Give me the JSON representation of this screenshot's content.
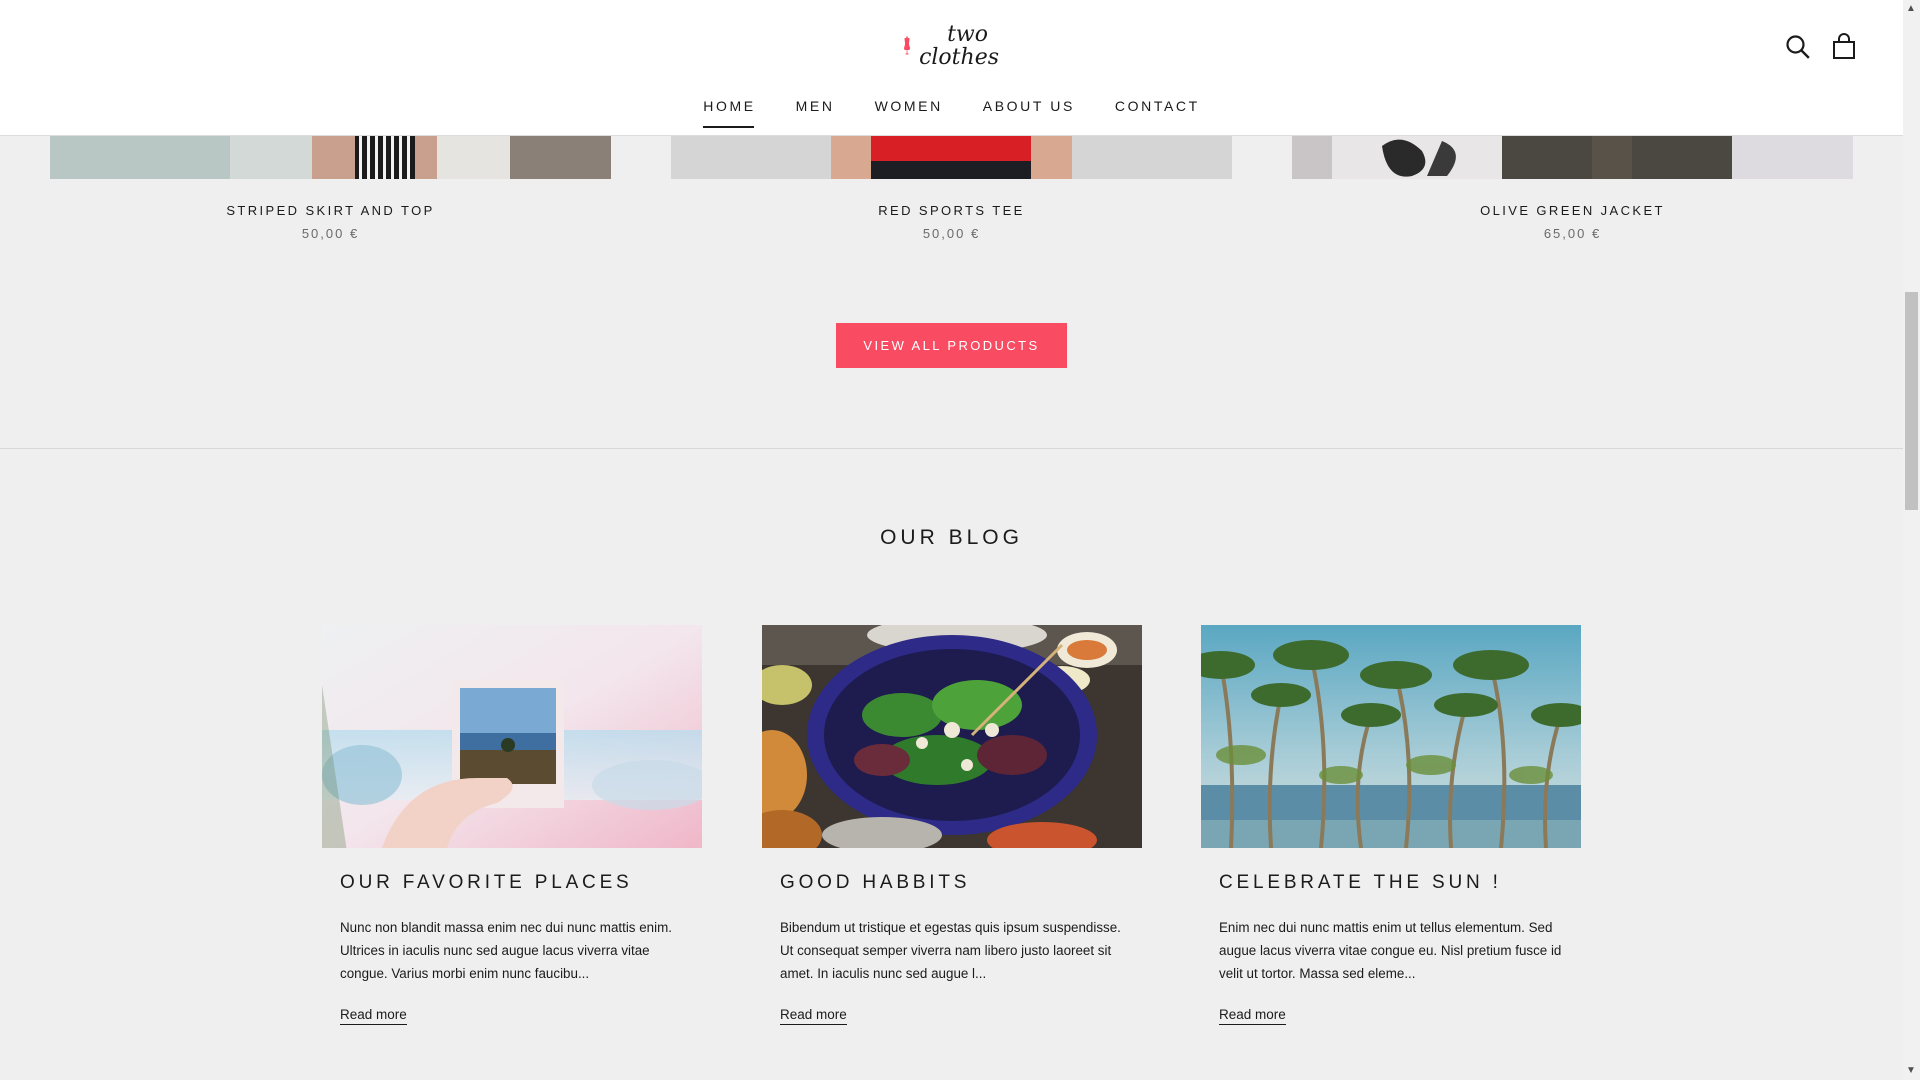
{
  "brand": {
    "logo_line1": "two",
    "logo_line2": "clothes",
    "accent_color": "#f94c63"
  },
  "header": {
    "nav": [
      {
        "label": "HOME",
        "active": true
      },
      {
        "label": "MEN"
      },
      {
        "label": "WOMEN"
      },
      {
        "label": "ABOUT US"
      },
      {
        "label": "CONTACT"
      }
    ],
    "icons": [
      "search-icon",
      "shopping-bag-icon"
    ]
  },
  "products": [
    {
      "title": "STRIPED SKIRT AND TOP",
      "price": "50,00 €"
    },
    {
      "title": "RED SPORTS TEE",
      "price": "50,00 €"
    },
    {
      "title": "OLIVE GREEN JACKET",
      "price": "65,00 €"
    }
  ],
  "cta": {
    "label": "VIEW ALL PRODUCTS"
  },
  "blog": {
    "title": "OUR BLOG",
    "posts": [
      {
        "title": "OUR FAVORITE PLACES",
        "excerpt": "Nunc non blandit massa enim nec dui nunc mattis enim. Ultrices in iaculis nunc sed augue lacus viverra vitae congue. Varius morbi enim nunc faucibu...",
        "link": "Read more"
      },
      {
        "title": "GOOD HABBITS",
        "excerpt": "Bibendum ut tristique et egestas quis ipsum suspendisse. Ut consequat semper viverra nam libero justo laoreet sit amet. In iaculis nunc sed augue l...",
        "link": "Read more"
      },
      {
        "title": "CELEBRATE THE SUN !",
        "excerpt": "Enim nec dui nunc mattis enim ut tellus elementum. Sed augue lacus viverra vitae congue eu. Nisl pretium fusce id velit ut tortor. Massa sed eleme...",
        "link": "Read more"
      }
    ]
  }
}
